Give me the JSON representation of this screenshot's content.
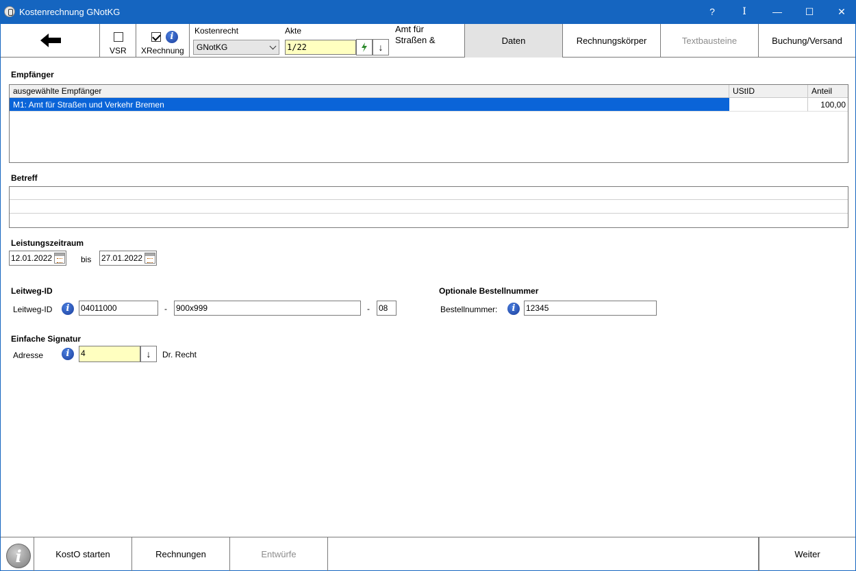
{
  "window": {
    "title": "Kostenrechnung GNotKG",
    "help_label": "?",
    "info_label": "I",
    "minimize_label": "—",
    "maximize_label": "☐",
    "close_label": "✕"
  },
  "toolbar": {
    "vsr_label": "VSR",
    "vsr_checked": false,
    "xrechnung_label": "XRechnung",
    "xrechnung_checked": true,
    "kostenrecht_label": "Kostenrecht",
    "kostenrecht_value": "GNotKG",
    "akte_label": "Akte",
    "akte_value": "1/22",
    "akte_name_line1": "Amt für",
    "akte_name_line2": "Straßen &",
    "tabs": [
      {
        "label": "Daten",
        "active": true,
        "disabled": false
      },
      {
        "label": "Rechnungskörper",
        "active": false,
        "disabled": false
      },
      {
        "label": "Textbausteine",
        "active": false,
        "disabled": true
      },
      {
        "label": "Buchung/Versand",
        "active": false,
        "disabled": false
      }
    ]
  },
  "empfaenger": {
    "section_title": "Empfänger",
    "columns": [
      "ausgewählte Empfänger",
      "UStID",
      "Anteil"
    ],
    "rows": [
      {
        "name": "M1: Amt für Straßen und Verkehr Bremen",
        "ustid": "",
        "anteil": "100,00"
      }
    ]
  },
  "betreff": {
    "section_title": "Betreff"
  },
  "leistungszeitraum": {
    "section_title": "Leistungszeitraum",
    "from": "12.01.2022",
    "bis_label": "bis",
    "to": "27.01.2022"
  },
  "leitweg": {
    "section_title": "Leitweg-ID",
    "label": "Leitweg-ID",
    "part1": "04011000",
    "part2": "900x999",
    "part3": "08",
    "separator": "-"
  },
  "bestellnummer": {
    "section_title": "Optionale Bestellnummer",
    "label": "Bestellnummer:",
    "value": "12345"
  },
  "signatur": {
    "section_title": "Einfache Signatur",
    "label": "Adresse",
    "value": "4",
    "name": "Dr. Recht"
  },
  "bottombar": {
    "kosto_label": "KostO starten",
    "rechnungen_label": "Rechnungen",
    "entwuerfe_label": "Entwürfe",
    "weiter_label": "Weiter"
  },
  "colors": {
    "titlebar": "#1565c0",
    "selection": "#0a64d8",
    "input_highlight": "#ffffc0"
  }
}
